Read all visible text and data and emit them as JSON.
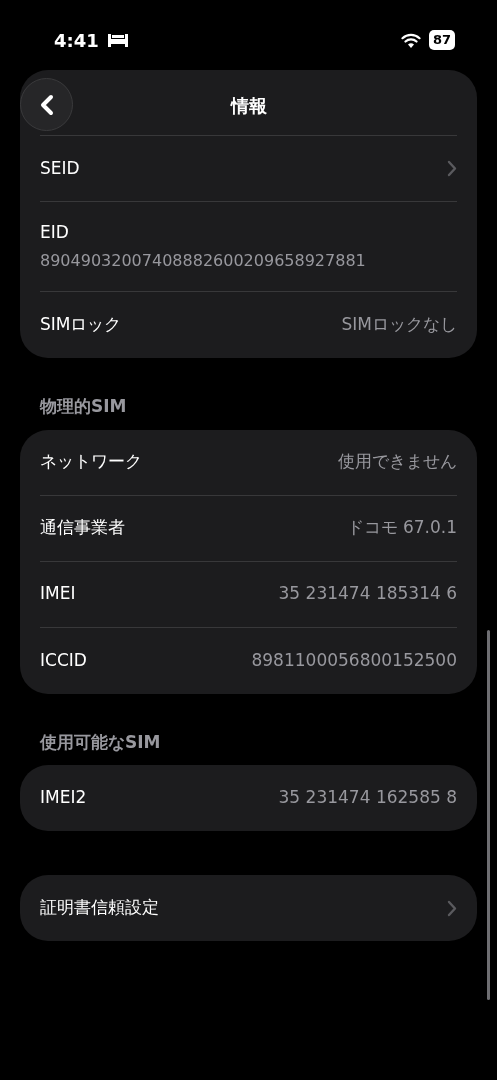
{
  "status_bar": {
    "time": "4:41",
    "battery": "87"
  },
  "nav": {
    "title": "情報"
  },
  "sections": [
    {
      "rows": [
        {
          "kind": "obscured"
        },
        {
          "kind": "chevron",
          "label": "SEID"
        },
        {
          "kind": "stacked",
          "label": "EID",
          "value": "89049032007408882600209658927881"
        },
        {
          "kind": "value",
          "label": "SIMロック",
          "value": "SIMロックなし"
        }
      ]
    },
    {
      "header": "物理的SIM",
      "rows": [
        {
          "kind": "value",
          "label": "ネットワーク",
          "value": "使用できません"
        },
        {
          "kind": "value",
          "label": "通信事業者",
          "value": "ドコモ 67.0.1"
        },
        {
          "kind": "value",
          "label": "IMEI",
          "value": "35 231474 185314 6"
        },
        {
          "kind": "value",
          "label": "ICCID",
          "value": "8981100056800152500"
        }
      ]
    },
    {
      "header": "使用可能なSIM",
      "rows": [
        {
          "kind": "value",
          "label": "IMEI2",
          "value": "35 231474 162585 8"
        }
      ]
    },
    {
      "rows": [
        {
          "kind": "chevron",
          "label": "証明書信頼設定"
        }
      ]
    }
  ]
}
